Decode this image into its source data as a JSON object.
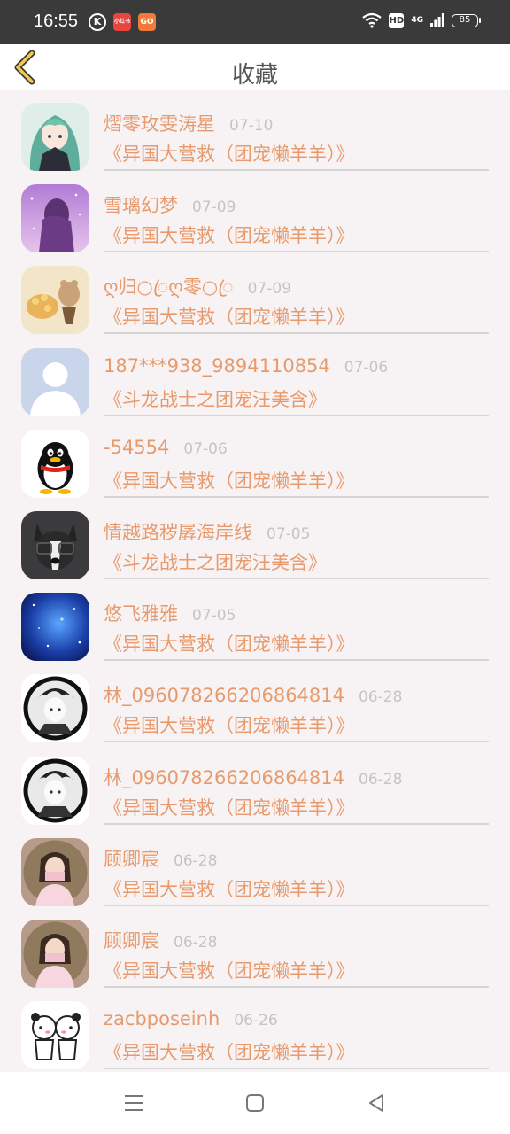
{
  "status_bar": {
    "time": "16:55",
    "badge_k": "K",
    "badge_xhs": "小红书",
    "badge_app": "GO",
    "hd_label": "HD",
    "network": "4G",
    "battery": "85"
  },
  "header": {
    "title": "收藏",
    "back_icon": "chevron-left-icon",
    "accent": "#f2c94c"
  },
  "colors": {
    "nickname": "#e89a6c",
    "date": "#c4c4c4",
    "book": "#e89a6c"
  },
  "favorites": [
    {
      "nickname": "熠零玫雯涛星",
      "date": "07-10",
      "book": "《异国大营救（团宠懒羊羊）》",
      "avatar": "anime-girl-green-hair"
    },
    {
      "nickname": "雪璃幻梦",
      "date": "07-09",
      "book": "《异国大营救（团宠懒羊羊）》",
      "avatar": "purple-girl-back"
    },
    {
      "nickname": "ღ归○ꦿღ零○ꦿ",
      "date": "07-09",
      "book": "《异国大营救（团宠懒羊羊）》",
      "avatar": "bear-with-bouquet"
    },
    {
      "nickname": "187***938_9894110854",
      "date": "07-06",
      "book": "《斗龙战士之团宠汪美含》",
      "avatar": "default-silhouette"
    },
    {
      "nickname": "-54554",
      "date": "07-06",
      "book": "《异国大营救（团宠懒羊羊）》",
      "avatar": "qq-penguin"
    },
    {
      "nickname": "情越路秽孱海岸线",
      "date": "07-05",
      "book": "《斗龙战士之团宠汪美含》",
      "avatar": "dog-with-glasses"
    },
    {
      "nickname": "悠飞雅雅",
      "date": "07-05",
      "book": "《异国大营救（团宠懒羊羊）》",
      "avatar": "blue-galaxy"
    },
    {
      "nickname": "林_096078266206864814",
      "date": "06-28",
      "book": "《异国大营救（团宠懒羊羊）》",
      "avatar": "ink-anime-boy"
    },
    {
      "nickname": "林_096078266206864814",
      "date": "06-28",
      "book": "《异国大营救（团宠懒羊羊）》",
      "avatar": "ink-anime-boy"
    },
    {
      "nickname": "顾卿宸",
      "date": "06-28",
      "book": "《异国大营救（团宠懒羊羊）》",
      "avatar": "girl-pink-mask"
    },
    {
      "nickname": "顾卿宸",
      "date": "06-28",
      "book": "《异国大营救（团宠懒羊羊）》",
      "avatar": "girl-pink-mask"
    },
    {
      "nickname": "zacbposeinh",
      "date": "06-26",
      "book": "《异国大营救（团宠懒羊羊）》",
      "avatar": "cartoon-couple-sketch"
    }
  ],
  "nav_bar": {
    "menu_icon": "menu-icon",
    "home_icon": "home-square-icon",
    "back_icon": "back-triangle-icon"
  }
}
